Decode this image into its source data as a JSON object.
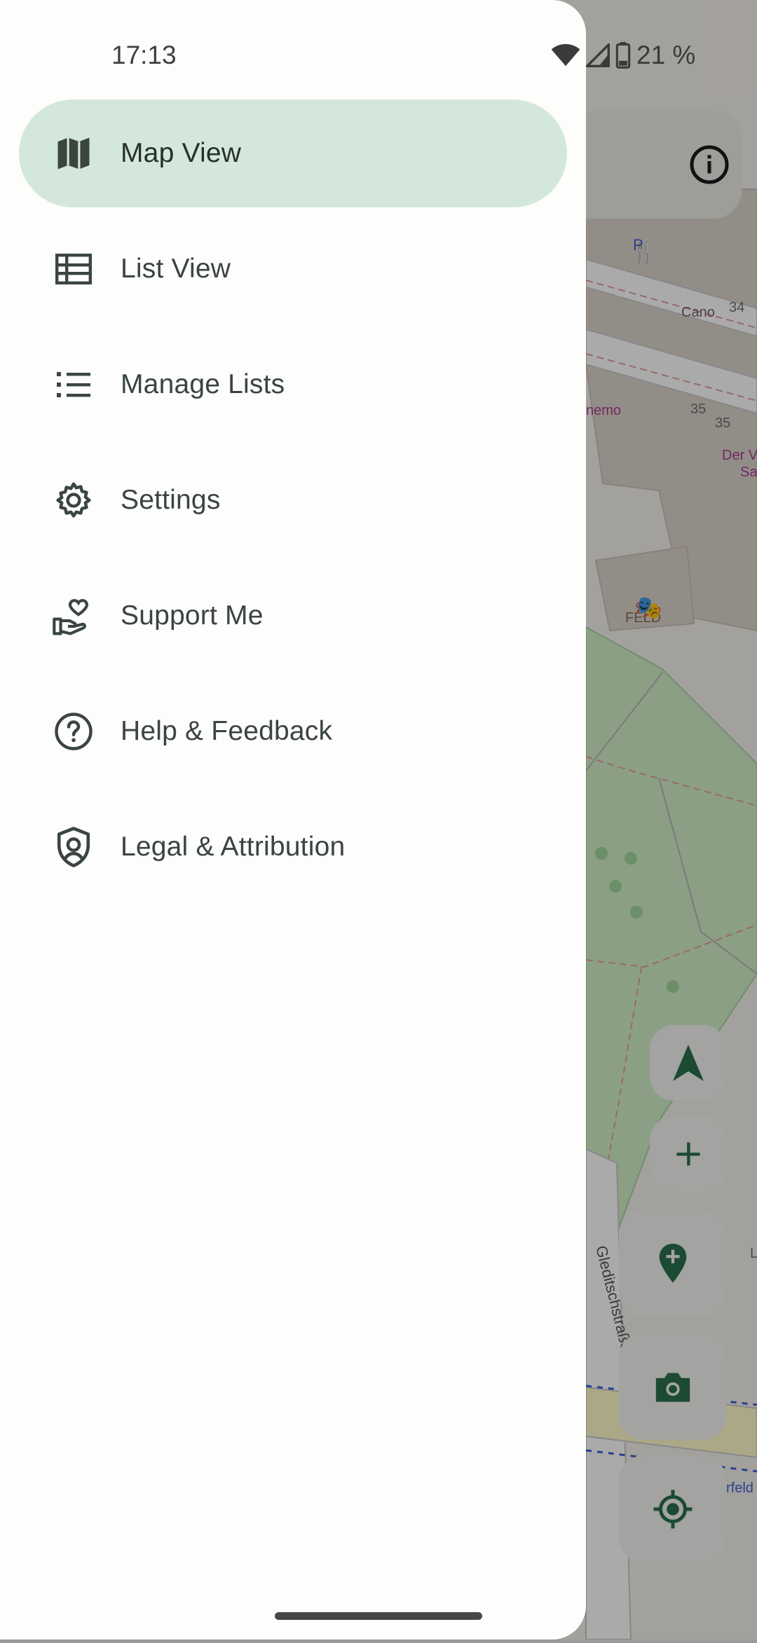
{
  "status_bar": {
    "time": "17:13",
    "battery": "21 %"
  },
  "drawer": {
    "items": [
      {
        "label": "Map View",
        "icon": "map-icon",
        "active": true
      },
      {
        "label": "List View",
        "icon": "list-view-icon",
        "active": false
      },
      {
        "label": "Manage Lists",
        "icon": "manage-lists-icon",
        "active": false
      },
      {
        "label": "Settings",
        "icon": "gear-icon",
        "active": false
      },
      {
        "label": "Support Me",
        "icon": "hand-heart-icon",
        "active": false
      },
      {
        "label": "Help & Feedback",
        "icon": "help-icon",
        "active": false
      },
      {
        "label": "Legal & Attribution",
        "icon": "shield-icon",
        "active": false
      }
    ]
  },
  "map": {
    "labels": {
      "cano": "Cano",
      "num_34": "34",
      "num_35a": "35",
      "num_35b": "35",
      "nemo": "nemo",
      "der": "Der V",
      "sa": "Sa",
      "feld": "FELD",
      "street": "Gleditschstraße",
      "feld2": "rfeld",
      "l": "L"
    }
  },
  "colors": {
    "accent_active_bg": "#d3e8db",
    "icon_dark": "#3b4540",
    "map_button_icon": "#1c5a3c"
  }
}
